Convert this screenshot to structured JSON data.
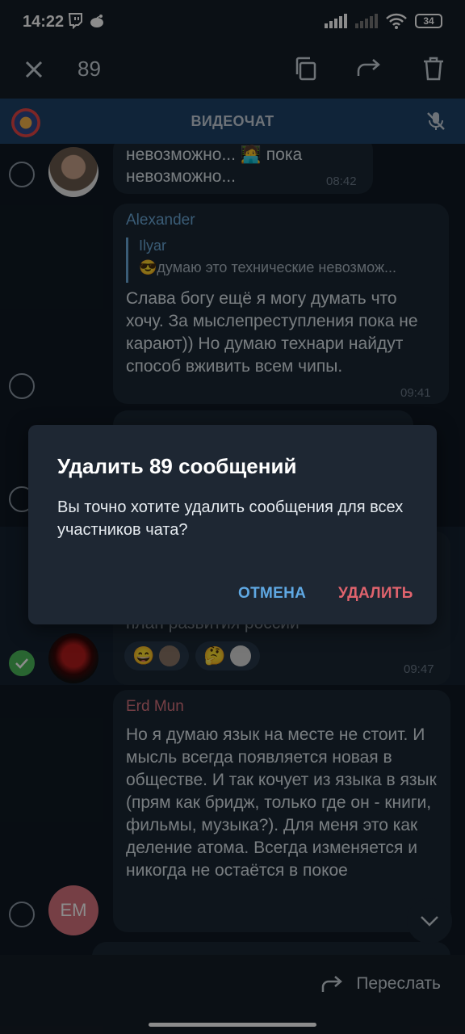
{
  "status_bar": {
    "time": "14:22",
    "battery": "34"
  },
  "action_bar": {
    "selected_count": "89"
  },
  "voice_chat_bar": {
    "title": "ВИДЕОЧАТ"
  },
  "messages": [
    {
      "id": "m1",
      "text_line1": "невозможно... 🧑‍💻 пока",
      "text_line2": "невозможно...",
      "time": "08:42"
    },
    {
      "id": "m2",
      "sender": "Alexander",
      "reply_name": "Ilyar",
      "reply_text": "😎думаю это технические невозмож...",
      "text": "Слава богу ещё я могу думать что хочу. За мыслепреступления пока не карают)) Но думаю технари найдут способ вживить всем чипы.",
      "time": "09:41"
    },
    {
      "id": "m3",
      "text_partial": "план развития россии",
      "time": "09:47",
      "reactions": [
        "😄",
        "🤔"
      ]
    },
    {
      "id": "m4",
      "sender": "Erd Mun",
      "avatar_initials": "EM",
      "text": "Но я думаю язык на месте не стоит. И мысль всегда появляется новая в обществе. И так кочует из языка в язык (прям как бридж, только где он - книги, фильмы, музыка?). Для меня это как деление атома. Всегда изменяется и никогда не остаётся в покое"
    }
  ],
  "dialog": {
    "title": "Удалить 89 сообщений",
    "body": "Вы точно хотите удалить сообщения для всех участников чата?",
    "cancel_label": "ОТМЕНА",
    "delete_label": "УДАЛИТЬ"
  },
  "bottom_bar": {
    "forward_label": "Переслать"
  },
  "colors": {
    "background": "#0e1621",
    "accent": "#5fa8e3",
    "danger": "#e0636d",
    "sender_alexander": "#6aa8d8",
    "sender_erd": "#d7747e"
  }
}
